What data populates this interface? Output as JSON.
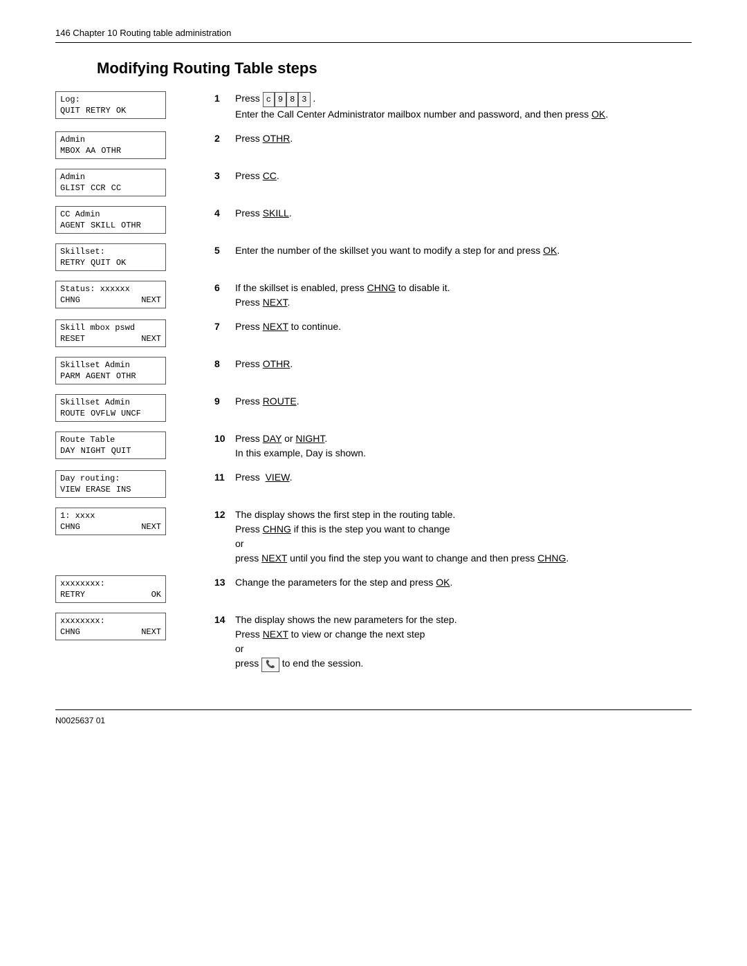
{
  "header": {
    "text": "146    Chapter 10  Routing table administration"
  },
  "page_title": "Modifying Routing Table steps",
  "steps": [
    {
      "number": "1",
      "screen": {
        "top": "Log:",
        "bottom": [
          "QUIT",
          "RETRY",
          "OK"
        ]
      },
      "text_parts": [
        {
          "type": "inline",
          "prefix": "Press ",
          "keys": [
            "c",
            "9",
            "8",
            "3"
          ],
          "suffix": "."
        },
        {
          "type": "block",
          "text": "Enter the Call Center Administrator mailbox number and password, and then press OK."
        }
      ]
    },
    {
      "number": "2",
      "screen": {
        "top": "Admin",
        "bottom": [
          "MBOX",
          "AA",
          "OTHR"
        ]
      },
      "text": "Press OTHR."
    },
    {
      "number": "3",
      "screen": {
        "top": "Admin",
        "bottom": [
          "GLIST",
          "CCR",
          "CC"
        ]
      },
      "text": "Press CC."
    },
    {
      "number": "4",
      "screen": {
        "top": "CC Admin",
        "bottom": [
          "AGENT",
          "SKILL",
          "OTHR"
        ]
      },
      "text": "Press SKILL."
    },
    {
      "number": "5",
      "screen": {
        "top": "Skillset:",
        "bottom": [
          "RETRY",
          "QUIT",
          "OK"
        ]
      },
      "text": "Enter the number of the skillset you want to modify a step for and press OK."
    },
    {
      "number": "6",
      "screen": {
        "top": "Status: xxxxxx",
        "bottom": [
          "CHNG",
          "",
          "NEXT"
        ]
      },
      "text_parts": [
        {
          "type": "block",
          "text": "If the skillset is enabled, press CHNG to disable it."
        },
        {
          "type": "block",
          "text": "Press NEXT."
        }
      ]
    },
    {
      "number": "7",
      "screen": {
        "top": "Skill mbox pswd",
        "bottom": [
          "RESET",
          "",
          "NEXT"
        ]
      },
      "text": "Press NEXT to continue."
    },
    {
      "number": "8",
      "screen": {
        "top": "Skillset Admin",
        "bottom": [
          "PARM",
          "AGENT",
          "OTHR"
        ]
      },
      "text": "Press OTHR."
    },
    {
      "number": "9",
      "screen": {
        "top": "Skillset Admin",
        "bottom": [
          "ROUTE",
          "OVFLW",
          "UNCF"
        ]
      },
      "text": "Press ROUTE."
    },
    {
      "number": "10",
      "screen": {
        "top": "Route Table",
        "bottom": [
          "DAY",
          "NIGHT",
          "QUIT"
        ]
      },
      "text_parts": [
        {
          "type": "block",
          "text": "Press DAY or NIGHT."
        },
        {
          "type": "block",
          "text": "In this example, Day is shown."
        }
      ]
    },
    {
      "number": "11",
      "screen": {
        "top": "Day routing:",
        "bottom": [
          "VIEW",
          "ERASE",
          "INS"
        ]
      },
      "text": "Press  VIEW."
    },
    {
      "number": "12",
      "screen": {
        "top": "1: xxxx",
        "bottom": [
          "CHNG",
          "",
          "NEXT"
        ]
      },
      "text_parts": [
        {
          "type": "block",
          "text": "The display shows the first step in the routing table."
        },
        {
          "type": "block",
          "text": "Press CHNG if this is the step you want to change"
        },
        {
          "type": "or"
        },
        {
          "type": "block",
          "text": "press NEXT until you find the step you want to change and then press CHNG."
        }
      ]
    },
    {
      "number": "13",
      "screen": {
        "top": "xxxxxxxx:",
        "bottom": [
          "RETRY",
          "",
          "OK"
        ]
      },
      "text": "Change the parameters for the step and press OK."
    },
    {
      "number": "14",
      "screen": {
        "top": "xxxxxxxx:",
        "bottom": [
          "CHNG",
          "",
          "NEXT"
        ]
      },
      "text_parts": [
        {
          "type": "block",
          "text": "The display shows the new parameters for the step."
        },
        {
          "type": "block",
          "text": "Press NEXT to view or change the next step"
        },
        {
          "type": "or"
        },
        {
          "type": "block",
          "text": "press  to end the session.",
          "has_phone_icon": true
        }
      ]
    }
  ],
  "footer": {
    "text": "N0025637 01"
  }
}
